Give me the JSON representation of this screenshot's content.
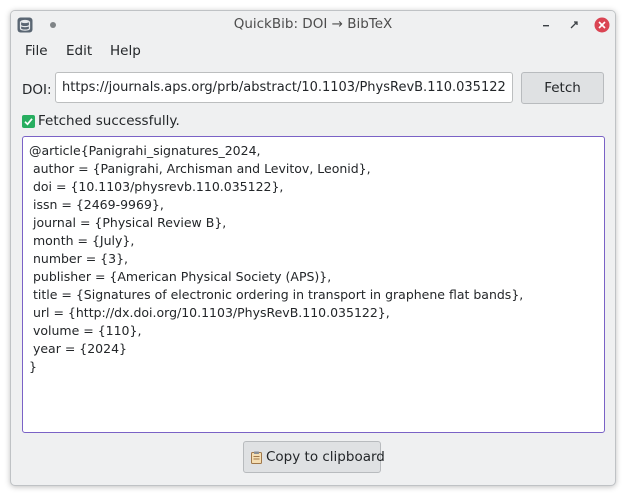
{
  "window": {
    "title": "QuickBib: DOI → BibTeX",
    "app_icon": "database-icon"
  },
  "menu": {
    "items": [
      "File",
      "Edit",
      "Help"
    ]
  },
  "doi": {
    "label": "DOI:",
    "value": "https://journals.aps.org/prb/abstract/10.1103/PhysRevB.110.035122",
    "fetch_label": "Fetch"
  },
  "status": {
    "icon": "check-icon",
    "text": "Fetched successfully."
  },
  "bibtex": {
    "content": "@article{Panigrahi_signatures_2024,\n author = {Panigrahi, Archisman and Levitov, Leonid},\n doi = {10.1103/physrevb.110.035122},\n issn = {2469-9969},\n journal = {Physical Review B},\n month = {July},\n number = {3},\n publisher = {American Physical Society (APS)},\n title = {Signatures of electronic ordering in transport in graphene flat bands},\n url = {http://dx.doi.org/10.1103/PhysRevB.110.035122},\n volume = {110},\n year = {2024}\n}"
  },
  "footer": {
    "copy_label": "Copy to clipboard",
    "copy_icon": "clipboard-icon"
  },
  "colors": {
    "accent": "#7a62c6",
    "close": "#da4453",
    "success": "#27ae60"
  }
}
